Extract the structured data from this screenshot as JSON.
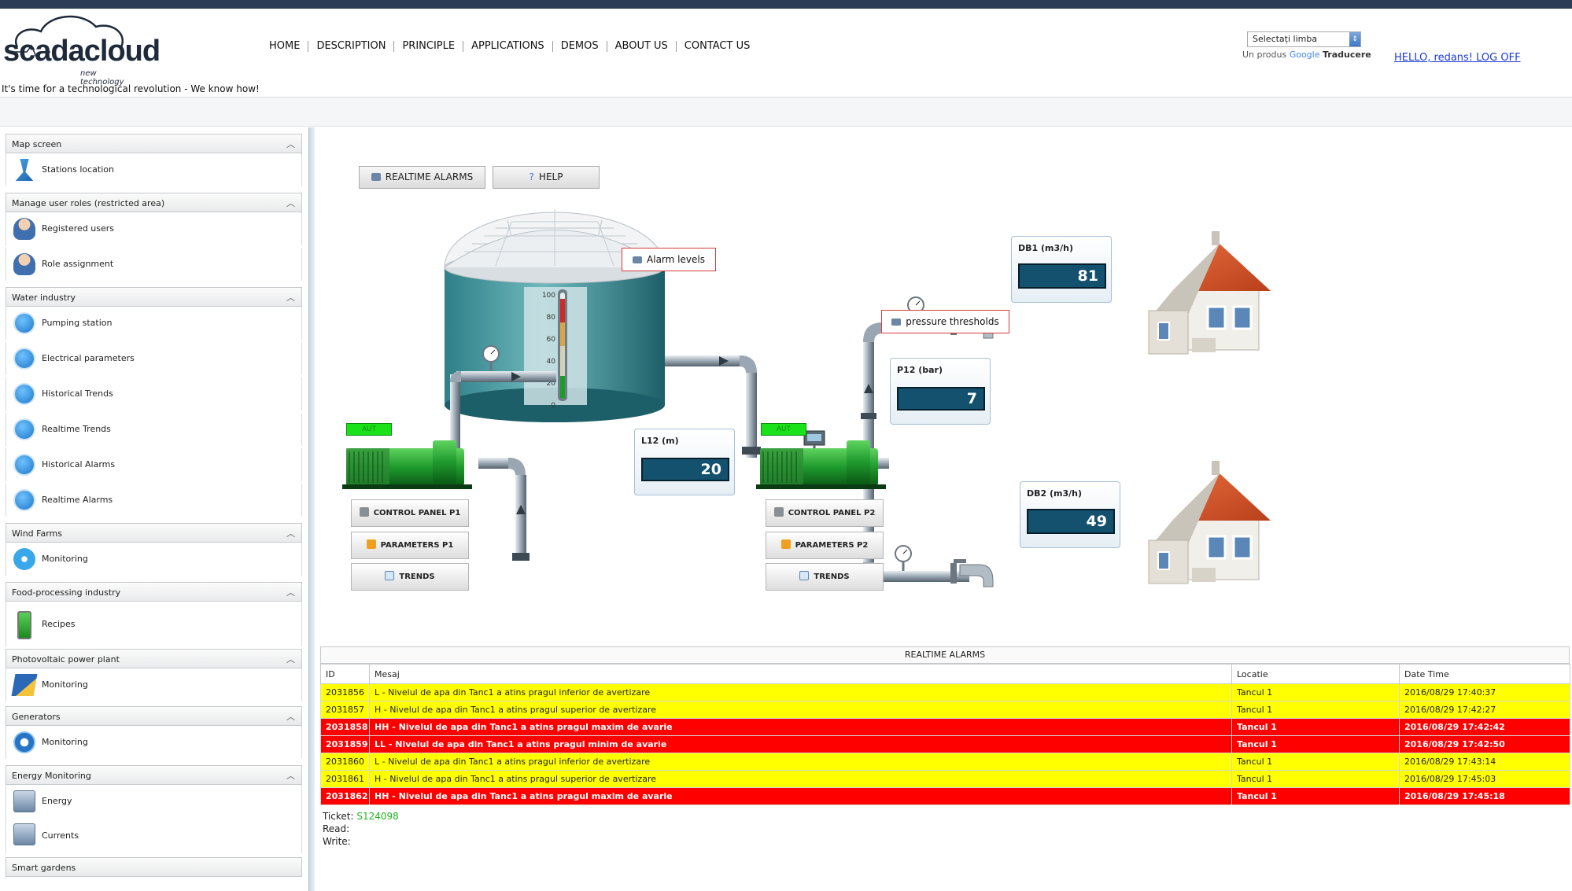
{
  "header": {
    "logo_word": "scadacloud",
    "logo_sub": "new technology",
    "tagline": "It's time for a technological revolution - We know how!",
    "nav": [
      "HOME",
      "DESCRIPTION",
      "PRINCIPLE",
      "APPLICATIONS",
      "DEMOS",
      "ABOUT US",
      "CONTACT US"
    ],
    "language_select": "Selectați limba",
    "google_credit_prefix": "Un produs",
    "google_credit_google": "Google",
    "google_credit_suffix": "Traducere",
    "user_link": "HELLO, redans! LOG OFF"
  },
  "sidebar": {
    "sections": [
      {
        "title": "Map screen",
        "items": [
          {
            "label": "Stations location",
            "icon": "map-pin-icon"
          }
        ]
      },
      {
        "title": "Manage user roles (restricted area)",
        "items": [
          {
            "label": "Registered users",
            "icon": "users-icon"
          },
          {
            "label": "Role assignment",
            "icon": "user-role-icon"
          }
        ]
      },
      {
        "title": "Water industry",
        "items": [
          {
            "label": "Pumping station",
            "icon": "water-tap-icon"
          },
          {
            "label": "Electrical parameters",
            "icon": "water-tap-icon"
          },
          {
            "label": "Historical Trends",
            "icon": "water-tap-icon"
          },
          {
            "label": "Realtime Trends",
            "icon": "water-tap-icon"
          },
          {
            "label": "Historical Alarms",
            "icon": "water-tap-icon"
          },
          {
            "label": "Realtime Alarms",
            "icon": "water-tap-icon"
          }
        ]
      },
      {
        "title": "Wind Farms",
        "items": [
          {
            "label": "Monitoring",
            "icon": "wind-turbine-icon"
          }
        ]
      },
      {
        "title": "Food-processing industry",
        "items": [
          {
            "label": "Recipes",
            "icon": "recipe-device-icon"
          }
        ]
      },
      {
        "title": "Photovoltaic power plant",
        "items": [
          {
            "label": "Monitoring",
            "icon": "solar-panel-icon"
          }
        ]
      },
      {
        "title": "Generators",
        "items": [
          {
            "label": "Monitoring",
            "icon": "generator-gear-icon"
          }
        ]
      },
      {
        "title": "Energy Monitoring",
        "items": [
          {
            "label": "Energy",
            "icon": "energy-meter-icon"
          },
          {
            "label": "Currents",
            "icon": "current-meter-icon"
          }
        ]
      },
      {
        "title": "Smart gardens",
        "items": []
      }
    ]
  },
  "main": {
    "buttons": {
      "realtime_alarms": "REALTIME ALARMS",
      "help": "HELP"
    },
    "alarm_levels": "Alarm levels",
    "pressure_thresholds": "pressure thresholds",
    "aut_label": "AUT",
    "tank_scale": [
      "100",
      "80",
      "60",
      "40",
      "20",
      "0"
    ],
    "tank_level_fraction": 0.2,
    "gauges": {
      "l12": {
        "label": "L12 (m)",
        "value": "20"
      },
      "p12": {
        "label": "P12 (bar)",
        "value": "7"
      },
      "db1": {
        "label": "DB1 (m3/h)",
        "value": "81"
      },
      "db2": {
        "label": "DB2 (m3/h)",
        "value": "49"
      }
    },
    "pump1": {
      "control": "CONTROL PANEL P1",
      "params": "PARAMETERS P1",
      "trends": "TRENDS"
    },
    "pump2": {
      "control": "CONTROL PANEL P2",
      "params": "PARAMETERS P2",
      "trends": "TRENDS"
    }
  },
  "alarms": {
    "title": "REALTIME ALARMS",
    "columns": [
      "ID",
      "Mesaj",
      "Locatie",
      "Date Time"
    ],
    "rows": [
      {
        "id": "2031856",
        "msg": "L - Nivelul de apa din Tanc1 a atins pragul inferior de avertizare",
        "loc": "Tancul 1",
        "time": "2016/08/29 17:40:37",
        "severity": "warn"
      },
      {
        "id": "2031857",
        "msg": "H - Nivelul de apa din Tanc1 a atins pragul superior de avertizare",
        "loc": "Tancul 1",
        "time": "2016/08/29 17:42:27",
        "severity": "warn"
      },
      {
        "id": "2031858",
        "msg": "HH - Nivelul de apa din Tanc1 a atins pragul maxim de avarie",
        "loc": "Tancul 1",
        "time": "2016/08/29 17:42:42",
        "severity": "crit"
      },
      {
        "id": "2031859",
        "msg": "LL - Nivelul de apa din Tanc1 a atins pragul minim de avarie",
        "loc": "Tancul 1",
        "time": "2016/08/29 17:42:50",
        "severity": "crit"
      },
      {
        "id": "2031860",
        "msg": "L - Nivelul de apa din Tanc1 a atins pragul inferior de avertizare",
        "loc": "Tancul 1",
        "time": "2016/08/29 17:43:14",
        "severity": "warn"
      },
      {
        "id": "2031861",
        "msg": "H - Nivelul de apa din Tanc1 a atins pragul superior de avertizare",
        "loc": "Tancul 1",
        "time": "2016/08/29 17:45:03",
        "severity": "warn"
      },
      {
        "id": "2031862",
        "msg": "HH - Nivelul de apa din Tanc1 a atins pragul maxim de avarie",
        "loc": "Tancul 1",
        "time": "2016/08/29 17:45:18",
        "severity": "crit"
      }
    ],
    "ticket_label": "Ticket:",
    "ticket_value": "S124098",
    "read_label": "Read:",
    "write_label": "Write:"
  },
  "colors": {
    "warn": "#ffff00",
    "crit": "#ff0000",
    "aut_green": "#19e219",
    "header_band": "#2c3e57"
  }
}
